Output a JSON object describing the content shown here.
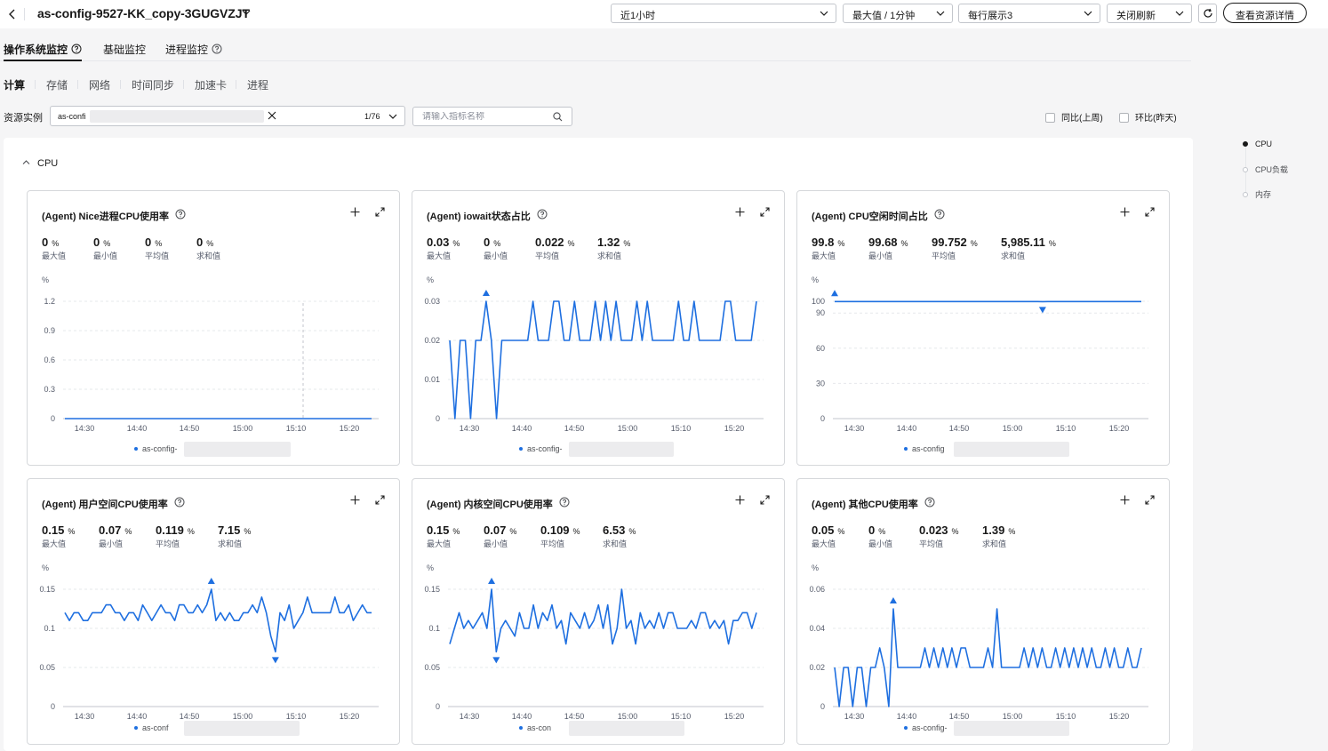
{
  "header": {
    "title": "as-config-9527-KK_copy-3GUGVZJT",
    "time_range": "近1小时",
    "aggregation": "最大值 / 1分钟",
    "per_row": "每行展示3",
    "auto_refresh": "关闭刷新",
    "detail_button": "查看资源详情"
  },
  "tabs": [
    {
      "label": "操作系统监控",
      "has_help": true
    },
    {
      "label": "基础监控",
      "has_help": false
    },
    {
      "label": "进程监控",
      "has_help": true
    }
  ],
  "subtabs": [
    "计算",
    "存储",
    "网络",
    "时间同步",
    "加速卡",
    "进程"
  ],
  "filters": {
    "resource_label": "资源实例",
    "resource_tag": "as-confi",
    "resource_count": "1/76",
    "metric_search_placeholder": "请输入指标名称",
    "compare_yoy": "同比(上周)",
    "compare_mom": "环比(昨天)"
  },
  "section": {
    "title": "CPU"
  },
  "anchor_nav": [
    "CPU",
    "CPU负载",
    "内存"
  ],
  "colors": {
    "series": "#1e6fe0",
    "accent": "#191919"
  },
  "stat_labels": [
    "最大值",
    "最小值",
    "平均值",
    "求和值"
  ],
  "x_ticks": [
    "14:30",
    "14:40",
    "14:50",
    "15:00",
    "15:10",
    "15:20"
  ],
  "cards": [
    {
      "title": "(Agent) Nice进程CPU使用率",
      "stats": [
        {
          "value": "0",
          "unit": "%"
        },
        {
          "value": "0",
          "unit": "%"
        },
        {
          "value": "0",
          "unit": "%"
        },
        {
          "value": "0",
          "unit": "%"
        }
      ],
      "y_unit": "%",
      "legend": "as-config-",
      "chart_data": {
        "type": "line",
        "ylim": [
          0,
          1.2
        ],
        "y_ticks": [
          "1.2",
          "0.9",
          "0.6",
          "0.3",
          "0"
        ],
        "values": [
          0,
          0,
          0,
          0,
          0,
          0,
          0,
          0,
          0,
          0,
          0,
          0,
          0,
          0,
          0,
          0,
          0,
          0,
          0,
          0,
          0,
          0,
          0,
          0,
          0,
          0,
          0,
          0,
          0,
          0,
          0,
          0,
          0,
          0,
          0,
          0,
          0,
          0,
          0,
          0,
          0,
          0,
          0,
          0,
          0,
          0,
          0,
          0,
          0,
          0,
          0,
          0,
          0,
          0,
          0,
          0,
          0,
          0,
          0,
          0
        ],
        "markers": []
      }
    },
    {
      "title": "(Agent) iowait状态占比",
      "stats": [
        {
          "value": "0.03",
          "unit": "%"
        },
        {
          "value": "0",
          "unit": "%"
        },
        {
          "value": "0.022",
          "unit": "%"
        },
        {
          "value": "1.32",
          "unit": "%"
        }
      ],
      "y_unit": "%",
      "legend": "as-config-",
      "chart_data": {
        "type": "line",
        "ylim": [
          0,
          0.03
        ],
        "y_ticks": [
          "0.03",
          "0.02",
          "0.01",
          "0"
        ],
        "values": [
          0.02,
          0,
          0.02,
          0.02,
          0,
          0.02,
          0.02,
          0.03,
          0.02,
          0,
          0.02,
          0.02,
          0.02,
          0.02,
          0.02,
          0.02,
          0.03,
          0.02,
          0.02,
          0.02,
          0.03,
          0.03,
          0.02,
          0.02,
          0.03,
          0.02,
          0.02,
          0.02,
          0.03,
          0.02,
          0.03,
          0.02,
          0.03,
          0.02,
          0.02,
          0.02,
          0.03,
          0.02,
          0.03,
          0.02,
          0.02,
          0.02,
          0.02,
          0.02,
          0.03,
          0.02,
          0.02,
          0.03,
          0.02,
          0.02,
          0.02,
          0.02,
          0.02,
          0.03,
          0.03,
          0.02,
          0.02,
          0.02,
          0.02,
          0.03
        ],
        "markers": [
          {
            "type": "max",
            "index": 7
          }
        ]
      }
    },
    {
      "title": "(Agent) CPU空闲时间占比",
      "stats": [
        {
          "value": "99.8",
          "unit": "%"
        },
        {
          "value": "99.68",
          "unit": "%"
        },
        {
          "value": "99.752",
          "unit": "%"
        },
        {
          "value": "5,985.11",
          "unit": "%"
        }
      ],
      "y_unit": "%",
      "legend": "as-config",
      "chart_data": {
        "type": "line",
        "ylim": [
          0,
          100
        ],
        "y_ticks": [
          "100",
          "90",
          "60",
          "30",
          "0"
        ],
        "values": [
          99.8,
          99.76,
          99.74,
          99.75,
          99.76,
          99.75,
          99.74,
          99.75,
          99.76,
          99.75,
          99.74,
          99.75,
          99.76,
          99.75,
          99.75,
          99.74,
          99.75,
          99.76,
          99.75,
          99.74,
          99.75,
          99.76,
          99.75,
          99.75,
          99.74,
          99.75,
          99.76,
          99.75,
          99.74,
          99.75,
          99.76,
          99.75,
          99.75,
          99.74,
          99.75,
          99.76,
          99.75,
          99.74,
          99.75,
          99.76,
          99.68,
          99.75,
          99.75,
          99.74,
          99.75,
          99.76,
          99.75,
          99.74,
          99.75,
          99.76,
          99.75,
          99.75,
          99.74,
          99.75,
          99.76,
          99.75,
          99.74,
          99.75,
          99.76,
          99.75
        ],
        "markers": [
          {
            "type": "max",
            "index": 0
          },
          {
            "type": "min",
            "index": 40
          }
        ]
      }
    },
    {
      "title": "(Agent) 用户空间CPU使用率",
      "stats": [
        {
          "value": "0.15",
          "unit": "%"
        },
        {
          "value": "0.07",
          "unit": "%"
        },
        {
          "value": "0.119",
          "unit": "%"
        },
        {
          "value": "7.15",
          "unit": "%"
        }
      ],
      "y_unit": "%",
      "legend": "as-conf",
      "chart_data": {
        "type": "line",
        "ylim": [
          0,
          0.15
        ],
        "y_ticks": [
          "0.15",
          "0.1",
          "0.05",
          "0"
        ],
        "values": [
          0.12,
          0.11,
          0.12,
          0.12,
          0.11,
          0.11,
          0.12,
          0.12,
          0.12,
          0.13,
          0.13,
          0.12,
          0.12,
          0.11,
          0.12,
          0.12,
          0.11,
          0.13,
          0.12,
          0.11,
          0.12,
          0.13,
          0.12,
          0.12,
          0.11,
          0.13,
          0.13,
          0.12,
          0.12,
          0.13,
          0.12,
          0.13,
          0.15,
          0.11,
          0.12,
          0.11,
          0.12,
          0.11,
          0.11,
          0.12,
          0.12,
          0.13,
          0.12,
          0.14,
          0.12,
          0.09,
          0.07,
          0.12,
          0.11,
          0.13,
          0.1,
          0.11,
          0.12,
          0.14,
          0.12,
          0.12,
          0.12,
          0.12,
          0.12,
          0.14,
          0.12,
          0.12,
          0.13,
          0.11,
          0.12,
          0.13,
          0.12,
          0.12
        ],
        "markers": [
          {
            "type": "max",
            "index": 32
          },
          {
            "type": "min",
            "index": 46
          }
        ]
      }
    },
    {
      "title": "(Agent) 内核空间CPU使用率",
      "stats": [
        {
          "value": "0.15",
          "unit": "%"
        },
        {
          "value": "0.07",
          "unit": "%"
        },
        {
          "value": "0.109",
          "unit": "%"
        },
        {
          "value": "6.53",
          "unit": "%"
        }
      ],
      "y_unit": "%",
      "legend": "as-con",
      "chart_data": {
        "type": "line",
        "ylim": [
          0,
          0.15
        ],
        "y_ticks": [
          "0.15",
          "0.1",
          "0.05",
          "0"
        ],
        "values": [
          0.08,
          0.1,
          0.12,
          0.1,
          0.11,
          0.1,
          0.11,
          0.12,
          0.1,
          0.15,
          0.07,
          0.1,
          0.11,
          0.1,
          0.09,
          0.12,
          0.1,
          0.1,
          0.13,
          0.1,
          0.12,
          0.11,
          0.13,
          0.1,
          0.11,
          0.08,
          0.12,
          0.11,
          0.1,
          0.12,
          0.1,
          0.11,
          0.13,
          0.1,
          0.13,
          0.08,
          0.1,
          0.15,
          0.1,
          0.11,
          0.08,
          0.12,
          0.1,
          0.11,
          0.1,
          0.12,
          0.1,
          0.12,
          0.12,
          0.1,
          0.1,
          0.1,
          0.11,
          0.1,
          0.12,
          0.12,
          0.1,
          0.11,
          0.1,
          0.11,
          0.08,
          0.11,
          0.11,
          0.12,
          0.12,
          0.1,
          0.12
        ],
        "markers": [
          {
            "type": "max",
            "index": 9
          },
          {
            "type": "min",
            "index": 10
          }
        ]
      }
    },
    {
      "title": "(Agent) 其他CPU使用率",
      "stats": [
        {
          "value": "0.05",
          "unit": "%"
        },
        {
          "value": "0",
          "unit": "%"
        },
        {
          "value": "0.023",
          "unit": "%"
        },
        {
          "value": "1.39",
          "unit": "%"
        }
      ],
      "y_unit": "%",
      "legend": "as-config-",
      "chart_data": {
        "type": "line",
        "ylim": [
          0,
          0.06
        ],
        "y_ticks": [
          "0.06",
          "0.04",
          "0.02",
          "0"
        ],
        "values": [
          0.02,
          0,
          0.02,
          0.02,
          0,
          0.02,
          0.02,
          0,
          0.02,
          0.02,
          0.03,
          0.02,
          0,
          0.05,
          0.02,
          0.02,
          0.02,
          0.02,
          0.02,
          0.02,
          0.03,
          0.02,
          0.03,
          0.02,
          0.03,
          0.02,
          0.03,
          0.02,
          0.03,
          0.03,
          0.02,
          0.02,
          0.02,
          0.02,
          0.03,
          0.02,
          0.05,
          0.02,
          0.02,
          0.02,
          0.02,
          0.02,
          0.03,
          0.02,
          0.03,
          0.02,
          0.03,
          0.02,
          0.02,
          0.03,
          0.02,
          0.03,
          0.02,
          0.03,
          0.02,
          0.03,
          0.02,
          0.03,
          0.02,
          0.02,
          0.03,
          0.02,
          0.03,
          0.02,
          0.02,
          0.03,
          0.02,
          0.02,
          0.03
        ],
        "markers": [
          {
            "type": "max",
            "index": 13
          }
        ]
      }
    }
  ]
}
